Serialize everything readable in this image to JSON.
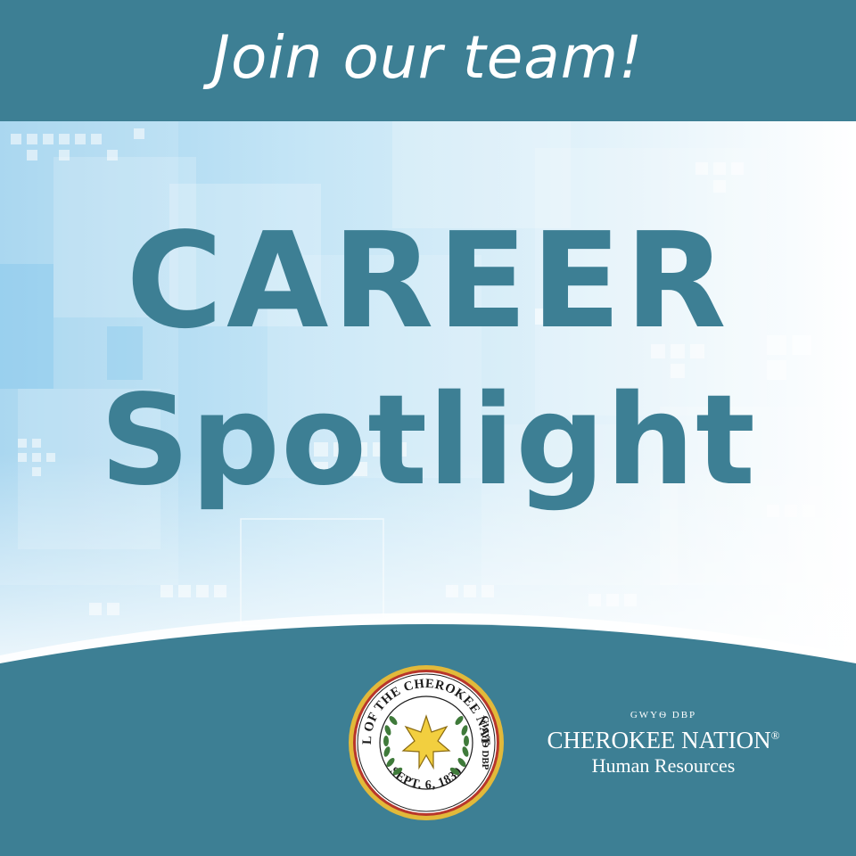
{
  "banner": {
    "headline": "Join our team!"
  },
  "hero": {
    "line1": "CAREER",
    "line2": "Spotlight"
  },
  "seal": {
    "ring_text_top": "SEAL OF THE CHEROKEE NATION",
    "ring_text_side": "GWYѲ DBP",
    "ring_text_bottom": "SEPT. 6, 1839",
    "icon": "seven-pointed-star-icon"
  },
  "organization": {
    "syllabary": "GWYѲ DBP",
    "name": "CHEROKEE NATION",
    "registered_mark": "®",
    "department": "Human Resources"
  },
  "colors": {
    "teal": "#3d7f94",
    "light_blue": "#9fd2ee",
    "gold": "#e2b93a",
    "seal_red": "#b8362b",
    "white": "#ffffff"
  }
}
